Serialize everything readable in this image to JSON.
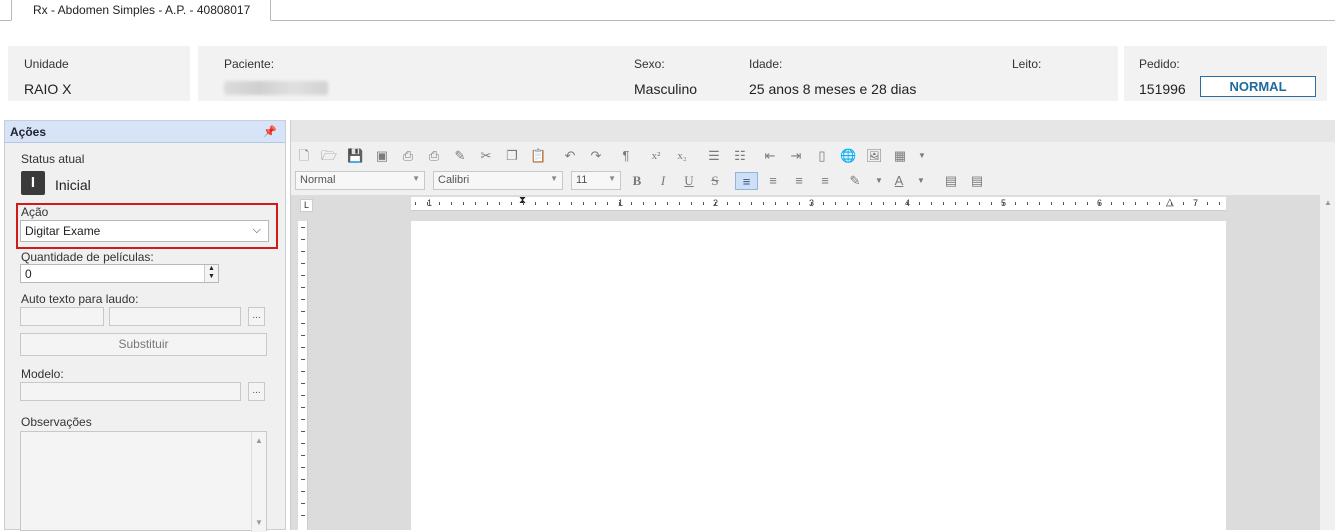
{
  "tab": {
    "title": "Rx - Abdomen Simples - A.P. - 40808017"
  },
  "info": {
    "unidade_label": "Unidade",
    "unidade_value": "RAIO X",
    "paciente_label": "Paciente:",
    "sexo_label": "Sexo:",
    "sexo_value": "Masculino",
    "idade_label": "Idade:",
    "idade_value": "25 anos 8 meses  e 28 dias",
    "leito_label": "Leito:",
    "pedido_label": "Pedido:",
    "pedido_value": "151996",
    "prioridade": "NORMAL"
  },
  "acoes": {
    "title": "Ações",
    "status_label": "Status atual",
    "status_icon_letter": "I",
    "status_value": "Inicial",
    "acao_label": "Ação",
    "acao_value": "Digitar Exame",
    "quantidade_label": "Quantidade de películas:",
    "quantidade_value": "0",
    "auto_texto_label": "Auto texto para laudo:",
    "dots": "...",
    "substituir_label": "Substituir",
    "modelo_label": "Modelo:",
    "observacoes_label": "Observações"
  },
  "editor": {
    "style_value": "Normal",
    "font_value": "Calibri",
    "size_value": "11",
    "ruler_numbers": [
      "1",
      "1",
      "2",
      "3",
      "4",
      "5",
      "6",
      "7"
    ],
    "corner_glyph": "L",
    "bold": "B",
    "italic": "I",
    "underline": "U",
    "strike": "S",
    "superscript": "x²",
    "subscript": "x₂",
    "font_color": "A"
  }
}
